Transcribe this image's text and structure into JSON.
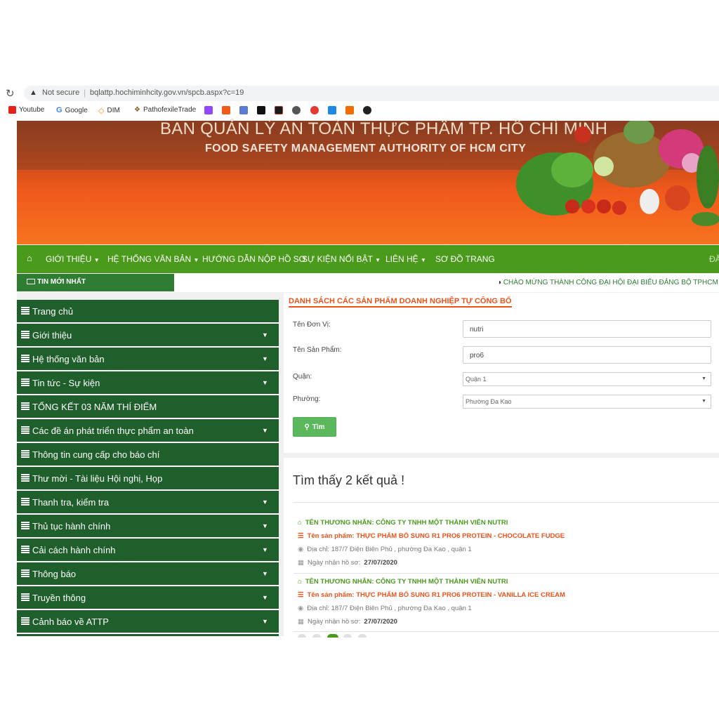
{
  "browser": {
    "security": "Not secure",
    "url": "bqlattp.hochiminhcity.gov.vn/spcb.aspx?c=19",
    "bookmarks": [
      "Youtube",
      "Google",
      "DIM",
      "PathofexileTrade"
    ]
  },
  "header": {
    "title": "BAN QUẢN LÝ AN TOÀN THỰC PHẨM TP. HỒ CHÍ MINH",
    "subtitle": "FOOD SAFETY MANAGEMENT AUTHORITY OF HCM CITY"
  },
  "nav": {
    "items": [
      "GIỚI THIỆU",
      "HỆ THỐNG VĂN BẢN",
      "HƯỚNG DẪN NỘP HỒ SƠ",
      "SỰ KIỆN NỔI BẬT",
      "LIÊN HỆ",
      "SƠ ĐỒ TRANG"
    ],
    "overflow": "ĐĂ"
  },
  "news": {
    "label": "TIN MỚI NHẤT",
    "ticker": "CHÀO MỪNG THÀNH CÔNG ĐẠI HỘI ĐẠI BIỂU ĐẢNG BỘ TPHCM LẦ"
  },
  "sidebar": {
    "items": [
      "Trang chủ",
      "Giới thiệu",
      "Hệ thống văn bản",
      "Tin tức - Sự kiện",
      "TỔNG KẾT 03 NĂM THÍ ĐIỂM",
      "Các đề án phát triển thực phẩm an toàn",
      "Thông tin cung cấp cho báo chí",
      "Thư mời - Tài liệu Hội nghị, Họp",
      "Thanh tra, kiểm tra",
      "Thủ tục hành chính",
      "Cải cách hành chính",
      "Thông báo",
      "Truyền thông",
      "Cảnh báo về ATTP"
    ]
  },
  "search": {
    "heading": "DANH SÁCH CÁC SẢN PHẨM DOANH NGHIỆP TỰ CÔNG BỐ",
    "unit_label": "Tên Đơn Vị:",
    "unit_value": "nutri",
    "product_label": "Tên Sản Phẩm:",
    "product_value": "pro6",
    "district_label": "Quận:",
    "district_value": "Quận 1",
    "ward_label": "Phường:",
    "ward_value": "Phường Đa Kao",
    "button": "Tìm"
  },
  "results": {
    "count_text": "Tìm thấy 2 kết quả !",
    "items": [
      {
        "merchant": "TÊN THƯƠNG NHÂN: CÔNG TY TNHH MỘT THÀNH VIÊN NUTRI",
        "product": "Tên sản phẩm: THỰC PHẨM BỔ SUNG R1 PRO6 PROTEIN - CHOCOLATE FUDGE",
        "address": "Địa chỉ: 187/7 Điện Biên Phủ , phường Đa Kao , quận 1",
        "date_label": "Ngày nhận hồ sơ:",
        "date": "27/07/2020"
      },
      {
        "merchant": "TÊN THƯƠNG NHÂN: CÔNG TY TNHH MỘT THÀNH VIÊN NUTRI",
        "product": "Tên sản phẩm: THỰC PHẨM BỔ SUNG R1 PRO6 PROTEIN - VANILLA ICE CREAM",
        "address": "Địa chỉ: 187/7 Điện Biên Phủ , phường Đa Kao , quận 1",
        "date_label": "Ngày nhận hồ sơ:",
        "date": "27/07/2020"
      }
    ]
  },
  "colors": {
    "nav_green": "#4a9a1c",
    "sidebar_green": "#1f5f2b",
    "accent_orange": "#e8541c",
    "button_green": "#5cb85c"
  }
}
